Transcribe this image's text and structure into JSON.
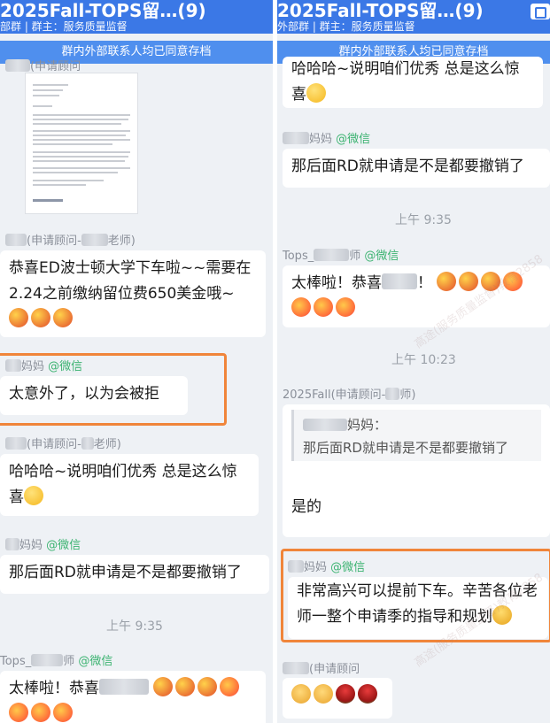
{
  "left": {
    "title": "2025Fall-TOPS留…(9)",
    "subtitle": "部群 | 群主：服务质量监督",
    "notice": "群内外部联系人均已同意存档",
    "sender1": "(申请顾问",
    "sender2": "(申请顾问-",
    "sender2b": "老师)",
    "msg_congrats": "恭喜ED波士顿大学下车啦~~需要在2.24之前缴纳留位费650美金哦~",
    "sender3": "妈妈",
    "sender3_wx": "@微信",
    "msg_surprise": "太意外了，以为会被拒",
    "sender4": "(申请顾问-",
    "sender4b": "老师)",
    "msg_haha": "哈哈哈~说明咱们优秀 总是这么惊喜",
    "sender5": "妈妈",
    "sender5_wx": "@微信",
    "msg_rd": "那后面RD就申请是不是都要撤销了",
    "time1": "上午 9:35",
    "sender6": "Tops_",
    "sender6b": "师",
    "sender6_wx": "@微信",
    "msg_great": "太棒啦！恭喜"
  },
  "right": {
    "title": "2025Fall-TOPS留…(9)",
    "subtitle": "外部群 | 群主：服务质量监督",
    "notice": "群内外部联系人均已同意存档",
    "msg_haha": "哈哈哈~说明咱们优秀 总是这么惊喜",
    "sender1": "妈妈",
    "sender1_wx": "@微信",
    "msg_rd": "那后面RD就申请是不是都要撤销了",
    "time1": "上午 9:35",
    "sender2": "Tops_",
    "sender2b": "师",
    "sender2_wx": "@微信",
    "msg_great": "太棒啦！恭喜",
    "time2": "上午 10:23",
    "sender3": "2025Fall",
    "sender3b": "(申请顾问-",
    "sender3c": "师)",
    "quote_name": "妈妈：",
    "quote_text": "那后面RD就申请是不是都要撤销了",
    "msg_yes": "是的",
    "sender4": "妈妈",
    "sender4_wx": "@微信",
    "msg_happy": "非常高兴可以提前下车。辛苦各位老师一整个申请季的指导和规划",
    "sender5": "(申请顾问",
    "watermark": "高途(服务质量监督)教育2858"
  },
  "colors": {
    "titlebar": "#3b78e6",
    "notice": "#4f8fee",
    "highlight": "#f0853a",
    "wechat": "#3cb371"
  }
}
